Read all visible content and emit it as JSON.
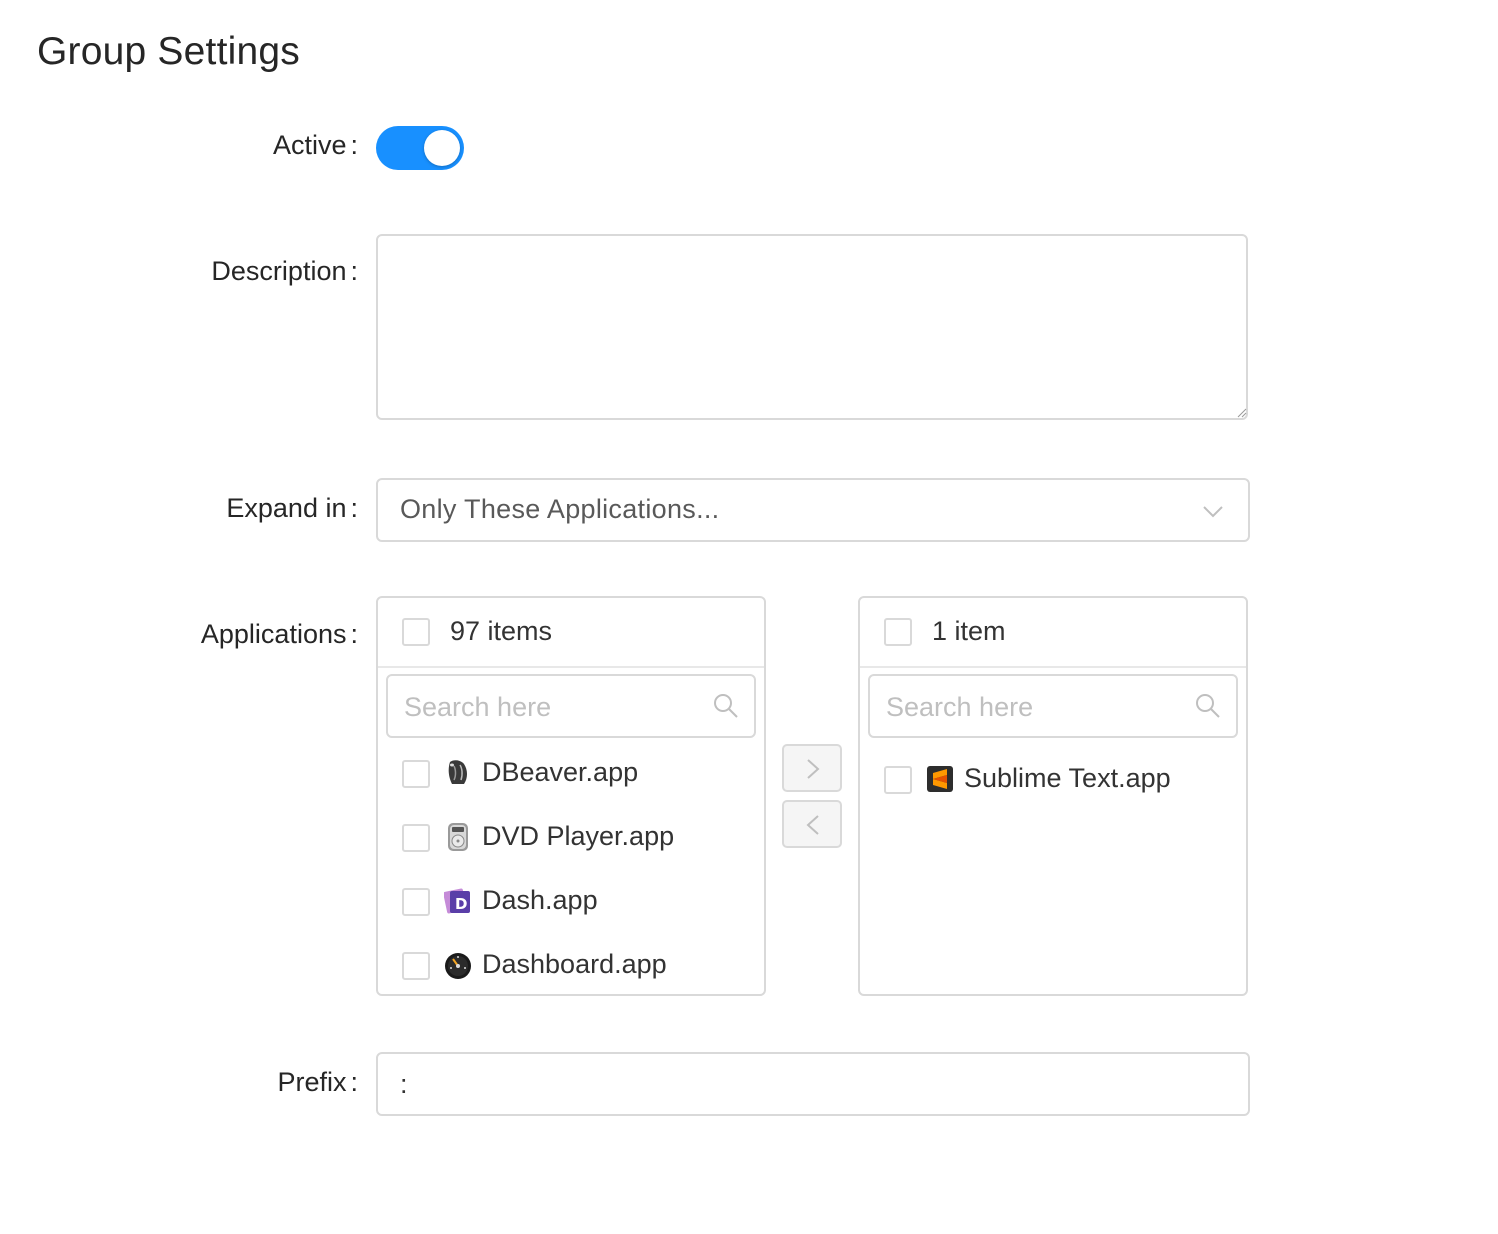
{
  "page": {
    "title": "Group Settings"
  },
  "form": {
    "active": {
      "label": "Active",
      "colon": ":",
      "value": true
    },
    "description": {
      "label": "Description",
      "colon": ":",
      "value": ""
    },
    "expand_in": {
      "label": "Expand in",
      "colon": ":",
      "selected": "Only These Applications..."
    },
    "applications": {
      "label": "Applications",
      "colon": ":",
      "source": {
        "count_label": "97 items",
        "search_placeholder": "Search here",
        "items": [
          {
            "name": "DBeaver.app",
            "icon": "dbeaver-icon"
          },
          {
            "name": "DVD Player.app",
            "icon": "dvd-player-icon"
          },
          {
            "name": "Dash.app",
            "icon": "dash-icon"
          },
          {
            "name": "Dashboard.app",
            "icon": "dashboard-icon"
          }
        ]
      },
      "target": {
        "count_label": "1 item",
        "search_placeholder": "Search here",
        "items": [
          {
            "name": "Sublime Text.app",
            "icon": "sublime-text-icon"
          }
        ]
      },
      "move_right_symbol": ">",
      "move_left_symbol": "<"
    },
    "prefix": {
      "label": "Prefix",
      "colon": ":",
      "value": ":"
    }
  },
  "colors": {
    "primary": "#1890ff",
    "border": "#d9d9d9",
    "text": "#262626",
    "placeholder": "#bfbfbf"
  }
}
